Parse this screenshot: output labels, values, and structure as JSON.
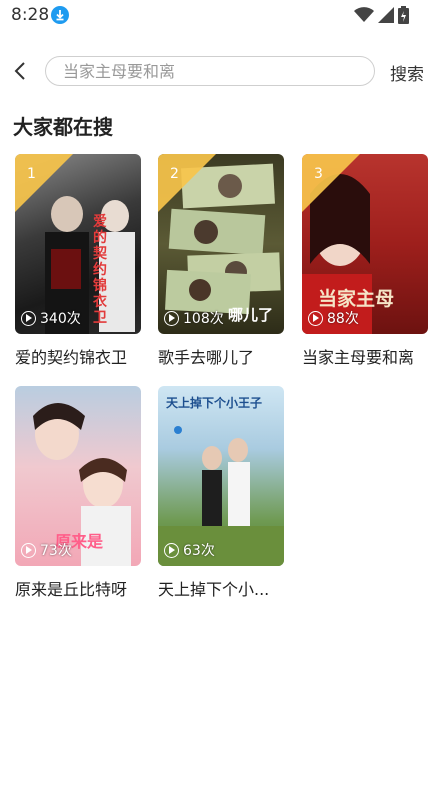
{
  "status": {
    "time": "8:28"
  },
  "search": {
    "placeholder": "当家主母要和离",
    "button_label": "搜索"
  },
  "section": {
    "title": "大家都在搜"
  },
  "colors": {
    "rank_badge": "#f7c44b",
    "accent": "#1e9bf0"
  },
  "results": [
    {
      "rank": "1",
      "title": "爱的契约锦衣卫",
      "plays": "340次",
      "poster_text": "爱的契约锦衣卫"
    },
    {
      "rank": "2",
      "title": "歌手去哪儿了",
      "plays": "108次",
      "poster_text": "哪儿了"
    },
    {
      "rank": "3",
      "title": "当家主母要和离",
      "plays": "88次",
      "poster_text": "当家主母"
    },
    {
      "title": "原来是丘比特呀",
      "plays": "73次",
      "poster_text": "原来是"
    },
    {
      "title": "天上掉下个小...",
      "plays": "63次",
      "poster_text": "天上掉下个小王子"
    }
  ]
}
